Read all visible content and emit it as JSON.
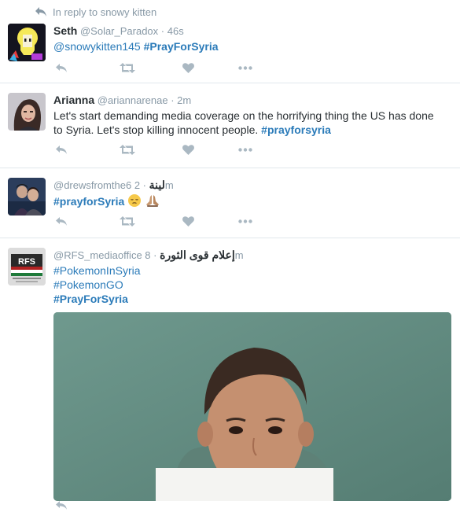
{
  "reply_context": {
    "label": "In reply to snowy kitten"
  },
  "tweets": [
    {
      "fullname": "Seth",
      "screen_name": "@Solar_Paradox",
      "time": "46s",
      "mention": "@snowykitten145",
      "hashtag": "#PrayForSyria"
    },
    {
      "fullname": "Arianna",
      "screen_name": "@ariannarenae",
      "time": "2m",
      "text_line1": "Let's start demanding media coverage on the horrifying thing the US has done",
      "text_line2": "to Syria. Let's stop killing innocent people.",
      "hashtag": "#prayforsyria"
    },
    {
      "screen_name": "@drewsfromthe6",
      "fullname": "لينة",
      "time": "2m",
      "hashtag": "#prayforSyria"
    },
    {
      "screen_name": "@RFS_mediaoffice",
      "fullname": "إعلام قوى الثورة",
      "time": "8m",
      "hashtags": [
        "#PokemonInSyria",
        "#PokemonGO",
        "#PrayForSyria"
      ],
      "avatar_text": "RFS"
    }
  ],
  "colors": {
    "link": "#2b7bb9",
    "muted": "#8899a6",
    "text": "#292f33",
    "divider": "#e1e8ed",
    "icon": "#aab8c2"
  },
  "icons": {
    "reply": "reply-arrow",
    "retweet": "retweet-arrows",
    "like": "heart",
    "more": "three-dots"
  }
}
